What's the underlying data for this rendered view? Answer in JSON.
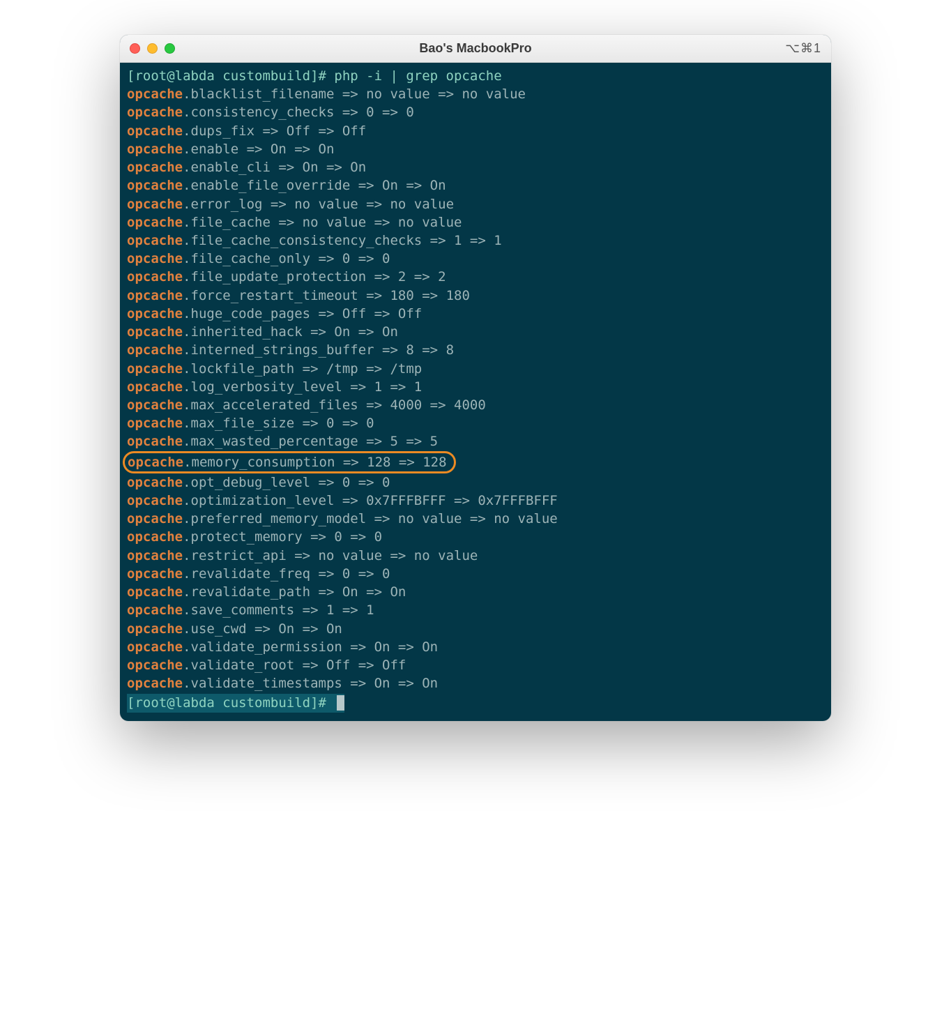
{
  "window": {
    "title": "Bao's MacbookPro",
    "shortcut": "⌥⌘1"
  },
  "prompt_top": "[root@labda custombuild]# php -i | grep opcache",
  "prompt_bottom": "[root@labda custombuild]# ",
  "highlight_index": 20,
  "lines": [
    {
      "key": "opcache",
      "rest": ".blacklist_filename => no value => no value"
    },
    {
      "key": "opcache",
      "rest": ".consistency_checks => 0 => 0"
    },
    {
      "key": "opcache",
      "rest": ".dups_fix => Off => Off"
    },
    {
      "key": "opcache",
      "rest": ".enable => On => On"
    },
    {
      "key": "opcache",
      "rest": ".enable_cli => On => On"
    },
    {
      "key": "opcache",
      "rest": ".enable_file_override => On => On"
    },
    {
      "key": "opcache",
      "rest": ".error_log => no value => no value"
    },
    {
      "key": "opcache",
      "rest": ".file_cache => no value => no value"
    },
    {
      "key": "opcache",
      "rest": ".file_cache_consistency_checks => 1 => 1"
    },
    {
      "key": "opcache",
      "rest": ".file_cache_only => 0 => 0"
    },
    {
      "key": "opcache",
      "rest": ".file_update_protection => 2 => 2"
    },
    {
      "key": "opcache",
      "rest": ".force_restart_timeout => 180 => 180"
    },
    {
      "key": "opcache",
      "rest": ".huge_code_pages => Off => Off"
    },
    {
      "key": "opcache",
      "rest": ".inherited_hack => On => On"
    },
    {
      "key": "opcache",
      "rest": ".interned_strings_buffer => 8 => 8"
    },
    {
      "key": "opcache",
      "rest": ".lockfile_path => /tmp => /tmp"
    },
    {
      "key": "opcache",
      "rest": ".log_verbosity_level => 1 => 1"
    },
    {
      "key": "opcache",
      "rest": ".max_accelerated_files => 4000 => 4000"
    },
    {
      "key": "opcache",
      "rest": ".max_file_size => 0 => 0"
    },
    {
      "key": "opcache",
      "rest": ".max_wasted_percentage => 5 => 5"
    },
    {
      "key": "opcache",
      "rest": ".memory_consumption => 128 => 128"
    },
    {
      "key": "opcache",
      "rest": ".opt_debug_level => 0 => 0"
    },
    {
      "key": "opcache",
      "rest": ".optimization_level => 0x7FFFBFFF => 0x7FFFBFFF"
    },
    {
      "key": "opcache",
      "rest": ".preferred_memory_model => no value => no value"
    },
    {
      "key": "opcache",
      "rest": ".protect_memory => 0 => 0"
    },
    {
      "key": "opcache",
      "rest": ".restrict_api => no value => no value"
    },
    {
      "key": "opcache",
      "rest": ".revalidate_freq => 0 => 0"
    },
    {
      "key": "opcache",
      "rest": ".revalidate_path => On => On"
    },
    {
      "key": "opcache",
      "rest": ".save_comments => 1 => 1"
    },
    {
      "key": "opcache",
      "rest": ".use_cwd => On => On"
    },
    {
      "key": "opcache",
      "rest": ".validate_permission => On => On"
    },
    {
      "key": "opcache",
      "rest": ".validate_root => Off => Off"
    },
    {
      "key": "opcache",
      "rest": ".validate_timestamps => On => On"
    }
  ]
}
